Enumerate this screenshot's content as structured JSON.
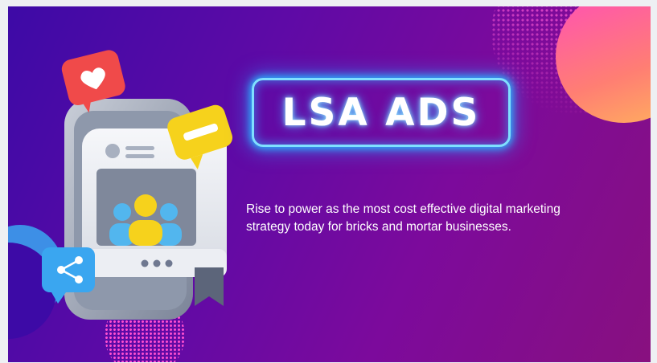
{
  "title": "LSA ADS",
  "description": "Rise to power as the most cost effective digital marketing strategy today for bricks and mortar businesses.",
  "icons": [
    "phone-illustration-icon",
    "heart-icon",
    "comment-icon",
    "share-icon",
    "users-icon",
    "bookmark-icon"
  ],
  "colors": {
    "background_start": "#3d0aa6",
    "background_end": "#88107f",
    "neon": "#7fe0ff",
    "accent_pink": "#ff4fd0",
    "accent_orange": "#ffb35c",
    "heart_bubble": "#f04a4a",
    "comment_bubble": "#f6d21c",
    "share_bubble": "#3aa6f0"
  }
}
